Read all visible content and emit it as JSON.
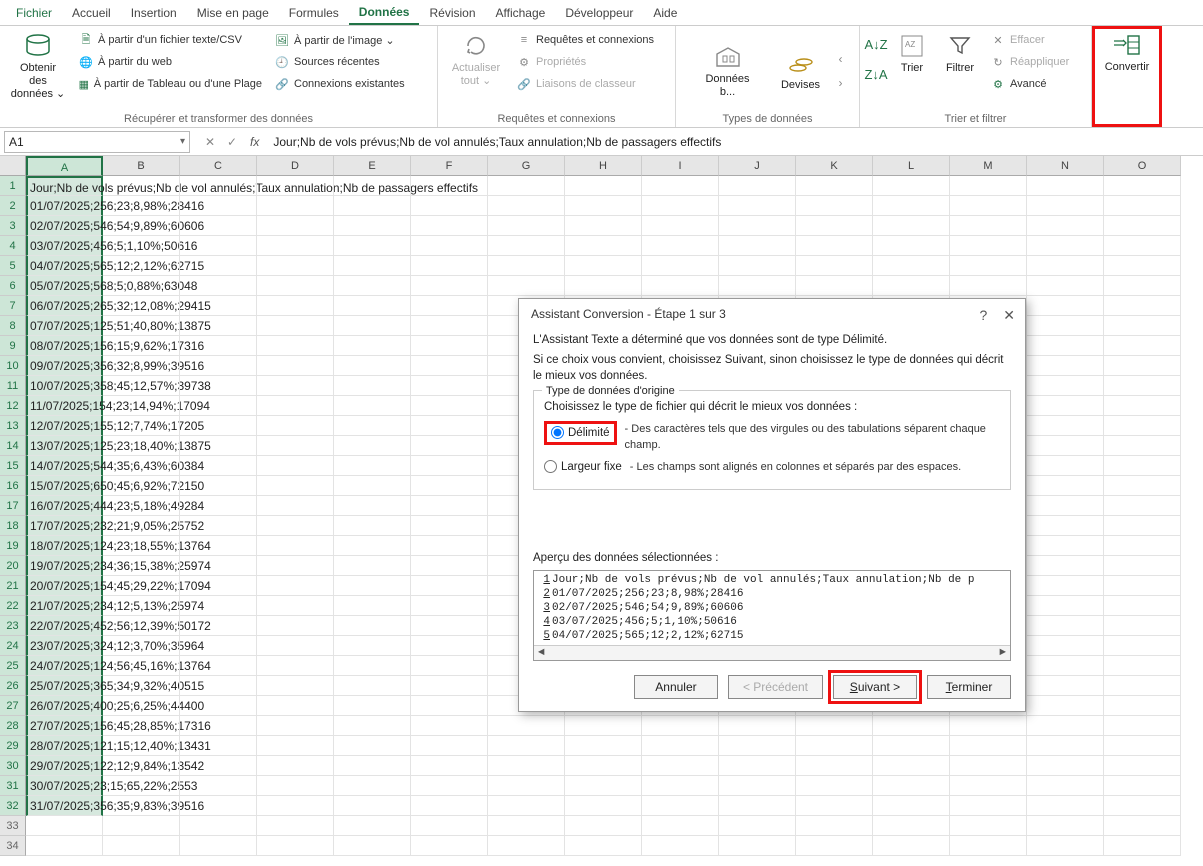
{
  "menubar": {
    "items": [
      "Fichier",
      "Accueil",
      "Insertion",
      "Mise en page",
      "Formules",
      "Données",
      "Révision",
      "Affichage",
      "Développeur",
      "Aide"
    ],
    "active_index": 5
  },
  "ribbon": {
    "groups": [
      {
        "title": "Récupérer et transformer des données",
        "big": {
          "label": "Obtenir des données ⌄"
        },
        "items": [
          "À partir d'un fichier texte/CSV",
          "À partir du web",
          "À partir de Tableau ou d'une Plage"
        ],
        "items2": [
          "À partir de l'image ⌄",
          "Sources récentes",
          "Connexions existantes"
        ]
      },
      {
        "title": "Requêtes et connexions",
        "big": {
          "label": "Actualiser tout ⌄"
        },
        "items": [
          "Requêtes et connexions",
          "Propriétés",
          "Liaisons de classeur"
        ]
      },
      {
        "title": "Types de données",
        "items": [
          "Données b...",
          "Devises"
        ]
      },
      {
        "title": "",
        "big1": {
          "label": "Trier"
        },
        "big2": {
          "label": "Filtrer"
        },
        "items": [
          "Effacer",
          "Réappliquer",
          "Avancé"
        ],
        "group_title": "Trier et filtrer"
      },
      {
        "title": "",
        "big": {
          "label": "Convertir"
        }
      }
    ]
  },
  "namebox": "A1",
  "formula_bar": "Jour;Nb de vols prévus;Nb de vol annulés;Taux annulation;Nb de passagers effectifs",
  "columns": [
    "A",
    "B",
    "C",
    "D",
    "E",
    "F",
    "G",
    "H",
    "I",
    "J",
    "K",
    "L",
    "M",
    "N",
    "O"
  ],
  "rows": [
    {
      "n": 1,
      "a": "Jour;Nb de vols prévus;Nb de vol annulés;Taux annulation;Nb de passagers effectifs"
    },
    {
      "n": 2,
      "a": "01/07/2025;256;23;8,98%;28416"
    },
    {
      "n": 3,
      "a": "02/07/2025;546;54;9,89%;60606"
    },
    {
      "n": 4,
      "a": "03/07/2025;456;5;1,10%;50616"
    },
    {
      "n": 5,
      "a": "04/07/2025;565;12;2,12%;62715"
    },
    {
      "n": 6,
      "a": "05/07/2025;568;5;0,88%;63048"
    },
    {
      "n": 7,
      "a": "06/07/2025;265;32;12,08%;29415"
    },
    {
      "n": 8,
      "a": "07/07/2025;125;51;40,80%;13875"
    },
    {
      "n": 9,
      "a": "08/07/2025;156;15;9,62%;17316"
    },
    {
      "n": 10,
      "a": "09/07/2025;356;32;8,99%;39516"
    },
    {
      "n": 11,
      "a": "10/07/2025;358;45;12,57%;39738"
    },
    {
      "n": 12,
      "a": "11/07/2025;154;23;14,94%;17094"
    },
    {
      "n": 13,
      "a": "12/07/2025;155;12;7,74%;17205"
    },
    {
      "n": 14,
      "a": "13/07/2025;125;23;18,40%;13875"
    },
    {
      "n": 15,
      "a": "14/07/2025;544;35;6,43%;60384"
    },
    {
      "n": 16,
      "a": "15/07/2025;650;45;6,92%;72150"
    },
    {
      "n": 17,
      "a": "16/07/2025;444;23;5,18%;49284"
    },
    {
      "n": 18,
      "a": "17/07/2025;232;21;9,05%;25752"
    },
    {
      "n": 19,
      "a": "18/07/2025;124;23;18,55%;13764"
    },
    {
      "n": 20,
      "a": "19/07/2025;234;36;15,38%;25974"
    },
    {
      "n": 21,
      "a": "20/07/2025;154;45;29,22%;17094"
    },
    {
      "n": 22,
      "a": "21/07/2025;234;12;5,13%;25974"
    },
    {
      "n": 23,
      "a": "22/07/2025;452;56;12,39%;50172"
    },
    {
      "n": 24,
      "a": "23/07/2025;324;12;3,70%;35964"
    },
    {
      "n": 25,
      "a": "24/07/2025;124;56;45,16%;13764"
    },
    {
      "n": 26,
      "a": "25/07/2025;365;34;9,32%;40515"
    },
    {
      "n": 27,
      "a": "26/07/2025;400;25;6,25%;44400"
    },
    {
      "n": 28,
      "a": "27/07/2025;156;45;28,85%;17316"
    },
    {
      "n": 29,
      "a": "28/07/2025;121;15;12,40%;13431"
    },
    {
      "n": 30,
      "a": "29/07/2025;122;12;9,84%;13542"
    },
    {
      "n": 31,
      "a": "30/07/2025;23;15;65,22%;2553"
    },
    {
      "n": 32,
      "a": "31/07/2025;356;35;9,83%;39516"
    },
    {
      "n": 33,
      "a": ""
    },
    {
      "n": 34,
      "a": ""
    }
  ],
  "dialog": {
    "title": "Assistant Conversion - Étape 1 sur 3",
    "help": "?",
    "close": "✕",
    "intro1": "L'Assistant Texte a déterminé que vos données sont de type Délimité.",
    "intro2": "Si ce choix vous convient, choisissez Suivant, sinon choisissez le type de données qui décrit le mieux vos données.",
    "fieldset_legend": "Type de données d'origine",
    "fs_intro": "Choisissez le type de fichier qui décrit le mieux vos données :",
    "radio1": {
      "label": "Délimité",
      "desc": "- Des caractères tels que des virgules ou des tabulations séparent chaque champ."
    },
    "radio2": {
      "label": "Largeur fixe",
      "desc": "- Les champs sont alignés en colonnes et séparés par des espaces."
    },
    "preview_label": "Aperçu des données sélectionnées :",
    "preview": [
      {
        "n": "1",
        "t": "Jour;Nb de vols prévus;Nb de vol annulés;Taux annulation;Nb de p"
      },
      {
        "n": "2",
        "t": "01/07/2025;256;23;8,98%;28416"
      },
      {
        "n": "3",
        "t": "02/07/2025;546;54;9,89%;60606"
      },
      {
        "n": "4",
        "t": "03/07/2025;456;5;1,10%;50616"
      },
      {
        "n": "5",
        "t": "04/07/2025;565;12;2,12%;62715"
      }
    ],
    "buttons": {
      "cancel": "Annuler",
      "back": "< Précédent",
      "next": "Suivant >",
      "finish": "Terminer"
    }
  }
}
